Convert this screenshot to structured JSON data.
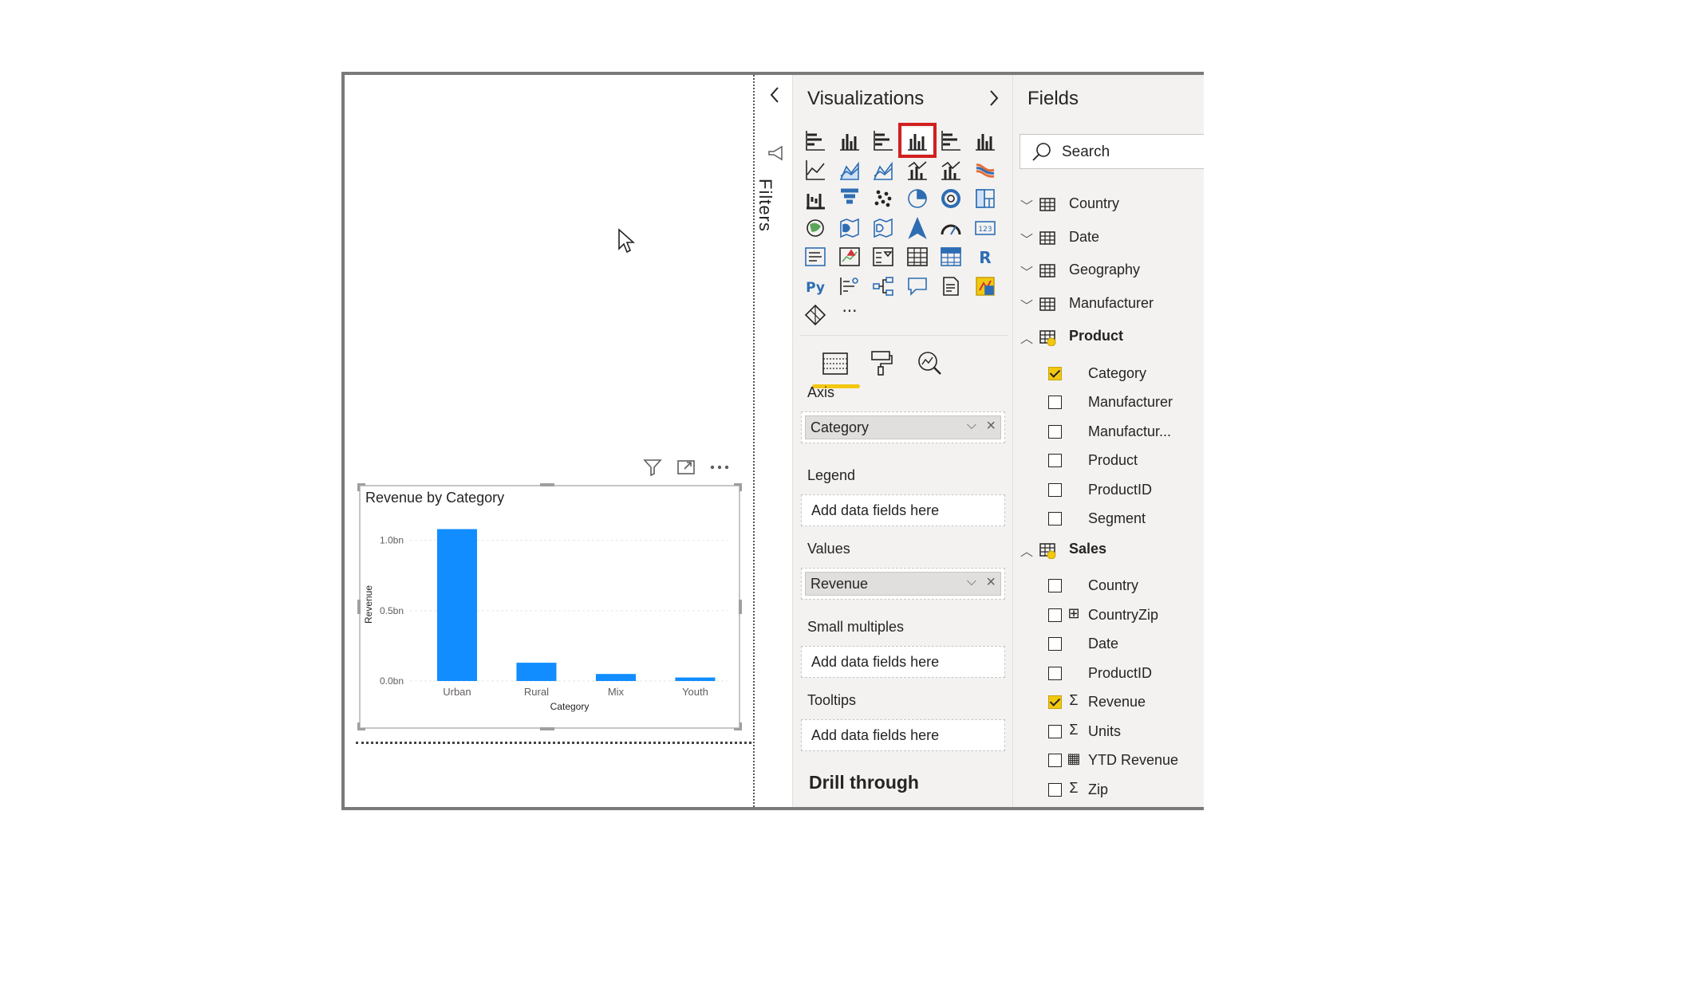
{
  "canvas": {
    "visual": {
      "title": "Revenue by Category",
      "header_icons": [
        "filter-icon",
        "focus-mode-icon",
        "more-options-icon"
      ]
    }
  },
  "chart_data": {
    "type": "bar",
    "title": "Revenue by Category",
    "xlabel": "Category",
    "ylabel": "Revenue",
    "categories": [
      "Urban",
      "Rural",
      "Mix",
      "Youth"
    ],
    "values": [
      1.08,
      0.13,
      0.05,
      0.025
    ],
    "yticks": [
      "0.0bn",
      "0.5bn",
      "1.0bn"
    ],
    "ytick_values": [
      0,
      0.5,
      1.0
    ],
    "ylim": [
      0,
      1.1
    ],
    "color": "#118dff",
    "grid": true
  },
  "filters": {
    "label": "Filters",
    "collapse_icon": "chevron-left-icon"
  },
  "visualizations": {
    "title": "Visualizations",
    "collapse_icon": "chevron-right-icon",
    "icons": [
      "stacked-bar-chart-icon",
      "stacked-column-chart-icon",
      "clustered-bar-chart-icon",
      "clustered-column-chart-icon",
      "100-stacked-bar-chart-icon",
      "100-stacked-column-chart-icon",
      "line-chart-icon",
      "area-chart-icon",
      "stacked-area-chart-icon",
      "line-and-stacked-column-chart-icon",
      "line-and-clustered-column-chart-icon",
      "ribbon-chart-icon",
      "waterfall-chart-icon",
      "funnel-chart-icon",
      "scatter-chart-icon",
      "pie-chart-icon",
      "donut-chart-icon",
      "treemap-icon",
      "map-icon",
      "filled-map-icon",
      "shape-map-icon",
      "azure-map-icon",
      "gauge-icon",
      "card-icon",
      "multi-row-card-icon",
      "kpi-icon",
      "slicer-icon",
      "table-icon",
      "matrix-icon",
      "r-visual-icon",
      "python-visual-icon",
      "key-influencers-icon",
      "decomposition-tree-icon",
      "qa-icon",
      "smart-narrative-icon",
      "paginated-report-icon",
      "power-apps-icon",
      "more-visuals-icon"
    ],
    "tabs": [
      "fields-tab-icon",
      "format-tab-icon",
      "analytics-tab-icon"
    ],
    "wells": [
      {
        "label": "Axis",
        "field": "Category"
      },
      {
        "label": "Legend",
        "placeholder": "Add data fields here"
      },
      {
        "label": "Values",
        "field": "Revenue"
      },
      {
        "label": "Small multiples",
        "placeholder": "Add data fields here"
      },
      {
        "label": "Tooltips",
        "placeholder": "Add data fields here"
      }
    ],
    "drill_through": "Drill through",
    "r_label": "R",
    "py_label": "Py",
    "more_label": "···"
  },
  "fields": {
    "title": "Fields",
    "search_placeholder": "Search",
    "tables": [
      {
        "name": "Country",
        "expanded": false
      },
      {
        "name": "Date",
        "expanded": false
      },
      {
        "name": "Geography",
        "expanded": false
      },
      {
        "name": "Manufacturer",
        "expanded": false
      },
      {
        "name": "Product",
        "expanded": true,
        "fields": [
          {
            "name": "Category",
            "checked": true,
            "type": ""
          },
          {
            "name": "Manufacturer",
            "checked": false,
            "type": ""
          },
          {
            "name": "Manufactur...",
            "checked": false,
            "type": ""
          },
          {
            "name": "Product",
            "checked": false,
            "type": ""
          },
          {
            "name": "ProductID",
            "checked": false,
            "type": ""
          },
          {
            "name": "Segment",
            "checked": false,
            "type": ""
          }
        ]
      },
      {
        "name": "Sales",
        "expanded": true,
        "fields": [
          {
            "name": "Country",
            "checked": false,
            "type": ""
          },
          {
            "name": "CountryZip",
            "checked": false,
            "type": "calc-column-icon"
          },
          {
            "name": "Date",
            "checked": false,
            "type": ""
          },
          {
            "name": "ProductID",
            "checked": false,
            "type": ""
          },
          {
            "name": "Revenue",
            "checked": true,
            "type": "sum-icon"
          },
          {
            "name": "Units",
            "checked": false,
            "type": "sum-icon"
          },
          {
            "name": "YTD Revenue",
            "checked": false,
            "type": "measure-icon"
          },
          {
            "name": "Zip",
            "checked": false,
            "type": "sum-icon"
          }
        ]
      }
    ]
  }
}
